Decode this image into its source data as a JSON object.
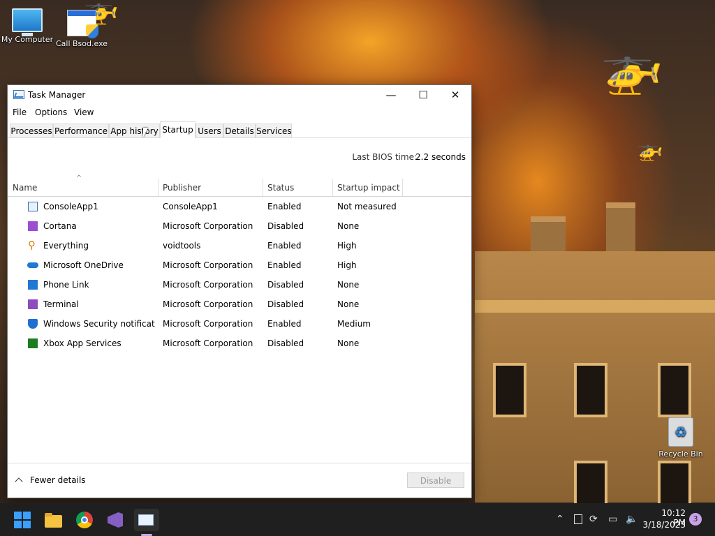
{
  "desktop": {
    "icons": [
      {
        "label": "My Computer",
        "icon": "monitor-icon"
      },
      {
        "label": "Call Bsod.exe",
        "icon": "exe-shield-icon"
      },
      {
        "label": "Recycle Bin",
        "icon": "recycle-bin-icon"
      }
    ]
  },
  "window": {
    "title": "Task Manager",
    "controls": {
      "minimize": "—",
      "maximize": "☐",
      "close": "✕"
    },
    "menu": [
      "File",
      "Options",
      "View"
    ],
    "tabs": [
      "Processes",
      "Performance",
      "App history",
      "Startup",
      "Users",
      "Details",
      "Services"
    ],
    "active_tab": "Startup",
    "bios_label": "Last BIOS time:",
    "bios_value": "2.2 seconds",
    "columns": [
      "Name",
      "Publisher",
      "Status",
      "Startup impact"
    ],
    "rows": [
      {
        "name": "ConsoleApp1",
        "publisher": "ConsoleApp1",
        "status": "Enabled",
        "impact": "Not measured",
        "icon": "console-app-icon",
        "color": "#3a6fb0"
      },
      {
        "name": "Cortana",
        "publisher": "Microsoft Corporation",
        "status": "Disabled",
        "impact": "None",
        "icon": "cortana-icon",
        "color": "#9b4fd0"
      },
      {
        "name": "Everything",
        "publisher": "voidtools",
        "status": "Enabled",
        "impact": "High",
        "icon": "search-icon",
        "color": "#e07a10"
      },
      {
        "name": "Microsoft OneDrive",
        "publisher": "Microsoft Corporation",
        "status": "Enabled",
        "impact": "High",
        "icon": "cloud-icon",
        "color": "#1e78d4"
      },
      {
        "name": "Phone Link",
        "publisher": "Microsoft Corporation",
        "status": "Disabled",
        "impact": "None",
        "icon": "phone-link-icon",
        "color": "#1e78d4"
      },
      {
        "name": "Terminal",
        "publisher": "Microsoft Corporation",
        "status": "Disabled",
        "impact": "None",
        "icon": "terminal-icon",
        "color": "#8e4cc0"
      },
      {
        "name": "Windows Security notificati...",
        "publisher": "Microsoft Corporation",
        "status": "Enabled",
        "impact": "Medium",
        "icon": "shield-icon",
        "color": "#1f6fd1"
      },
      {
        "name": "Xbox App Services",
        "publisher": "Microsoft Corporation",
        "status": "Disabled",
        "impact": "None",
        "icon": "xbox-icon",
        "color": "#1c7c22"
      }
    ],
    "footer": {
      "fewer_details": "Fewer details",
      "disable_button": "Disable"
    }
  },
  "taskbar": {
    "apps": [
      "start-icon",
      "file-explorer-icon",
      "chrome-icon",
      "visual-studio-icon",
      "task-manager-icon"
    ],
    "tray": [
      "chevron-up-icon",
      "tablet-icon",
      "sync-icon",
      "network-icon",
      "volume-icon"
    ],
    "time": "10:12 PM",
    "date": "3/18/2023",
    "notifications": "3"
  }
}
